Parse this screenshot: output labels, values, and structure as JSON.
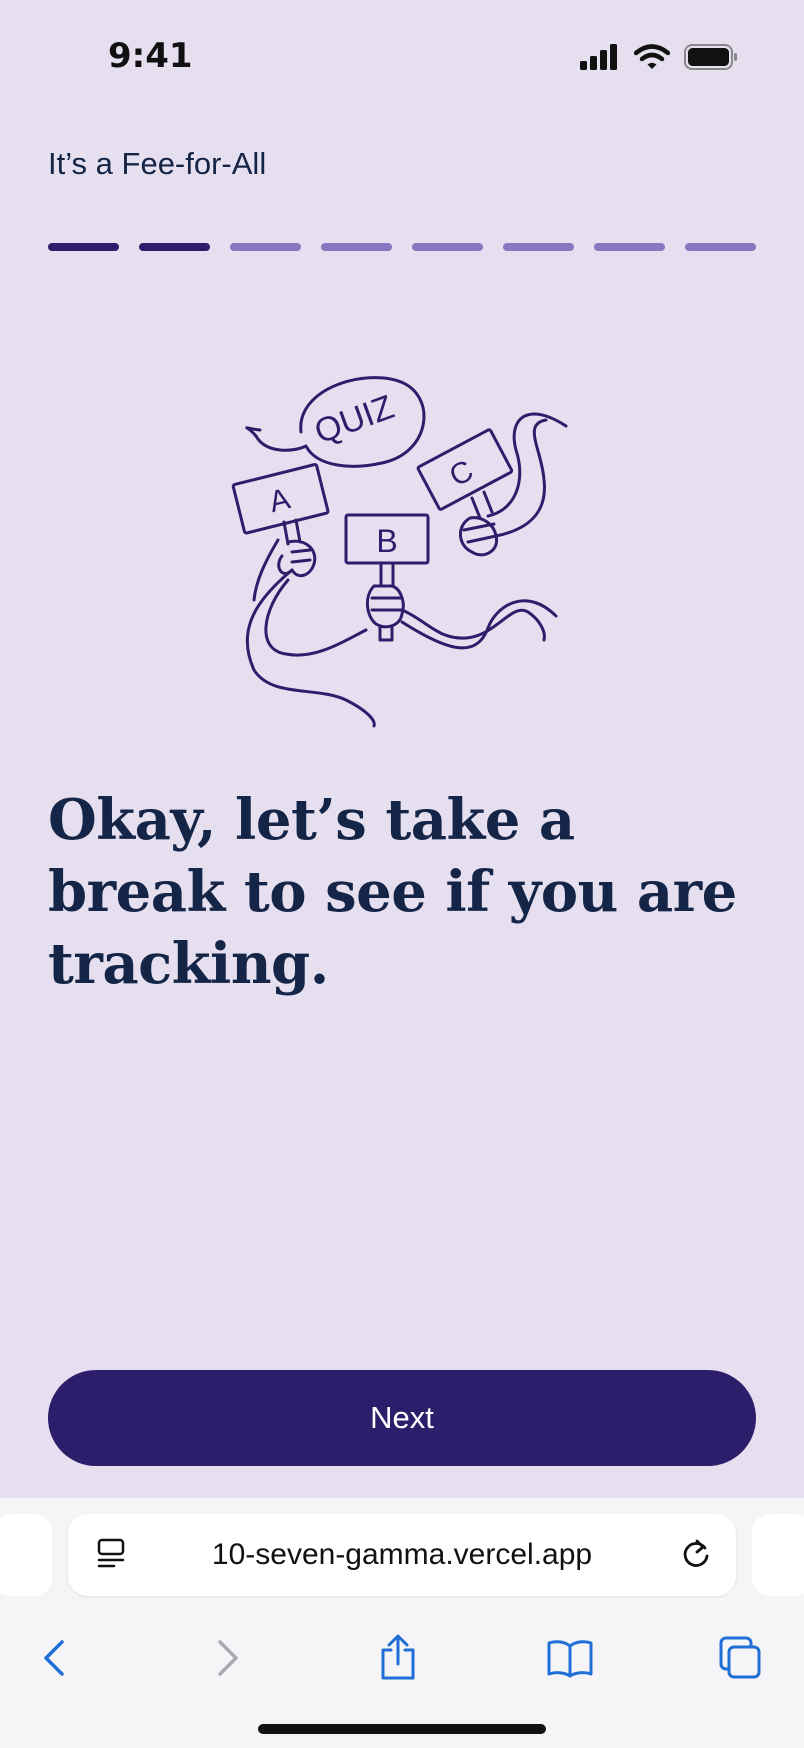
{
  "status_bar": {
    "time": "9:41"
  },
  "header": {
    "title": "It’s a Fee-for-All"
  },
  "progress": {
    "total_steps": 8,
    "completed_steps": 2
  },
  "illustration": {
    "bubble_text": "QUIZ",
    "sign_a": "A",
    "sign_b": "B",
    "sign_c": "C"
  },
  "main": {
    "headline": "Okay, let’s take a break to see if you are tracking."
  },
  "actions": {
    "next_label": "Next"
  },
  "browser": {
    "url": "10-seven-gamma.vercel.app"
  },
  "colors": {
    "background": "#e6dfef",
    "accent": "#2d1e6b",
    "progress_inactive": "#8a75c0",
    "text": "#152547",
    "ios_blue": "#1f6fd6"
  }
}
